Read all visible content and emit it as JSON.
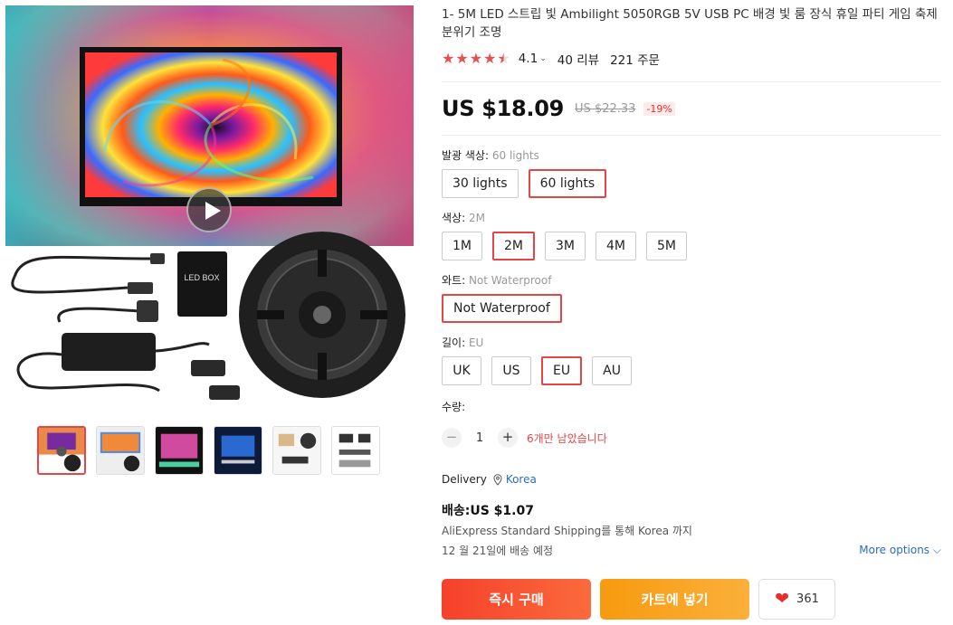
{
  "product": {
    "title": "1- 5M LED 스트립 빛 Ambilight 5050RGB 5V USB PC 배경 빛 룸 장식 휴일 파티 게임 축제 분위기 조명",
    "rating": "4.1",
    "rating_stars": 4.5,
    "reviews": "40 리뷰",
    "orders": "221 주문",
    "led_box_label": "LED BOX"
  },
  "price": {
    "current": "US $18.09",
    "original": "US $22.33",
    "discount": "-19%"
  },
  "properties": [
    {
      "label": "발광 색상:",
      "selected": "60 lights",
      "options": [
        "30 lights",
        "60 lights"
      ],
      "active": 1
    },
    {
      "label": "색상:",
      "selected": "2M",
      "options": [
        "1M",
        "2M",
        "3M",
        "4M",
        "5M"
      ],
      "active": 1
    },
    {
      "label": "와트:",
      "selected": "Not Waterproof",
      "options": [
        "Not Waterproof"
      ],
      "active": 0
    },
    {
      "label": "길이:",
      "selected": "EU",
      "options": [
        "UK",
        "US",
        "EU",
        "AU"
      ],
      "active": 2
    }
  ],
  "quantity": {
    "label": "수량:",
    "minus": "−",
    "value": "1",
    "plus": "+",
    "stock": "6개만 남았습니다"
  },
  "delivery": {
    "label": "Delivery",
    "destination": "Korea",
    "shipping_price": "배송:US $1.07",
    "method": "AliExpress Standard Shipping를 통해 Korea 까지",
    "date": "12 월 21일에 배송 예정",
    "more_options": "More options"
  },
  "actions": {
    "buy_now": "즉시 구매",
    "add_to_cart": "카트에 넣기",
    "wishlist_count": "361"
  },
  "icons": {
    "play": "play-icon",
    "pin": "location-pin-icon",
    "heart": "heart-icon",
    "star": "star-icon",
    "chevron": "chevron-down-icon"
  },
  "colors": {
    "accent_red": "#e64545",
    "buy_button": "#f5412b",
    "cart_button": "#f79a0f",
    "link_blue": "#2a6ebb"
  }
}
